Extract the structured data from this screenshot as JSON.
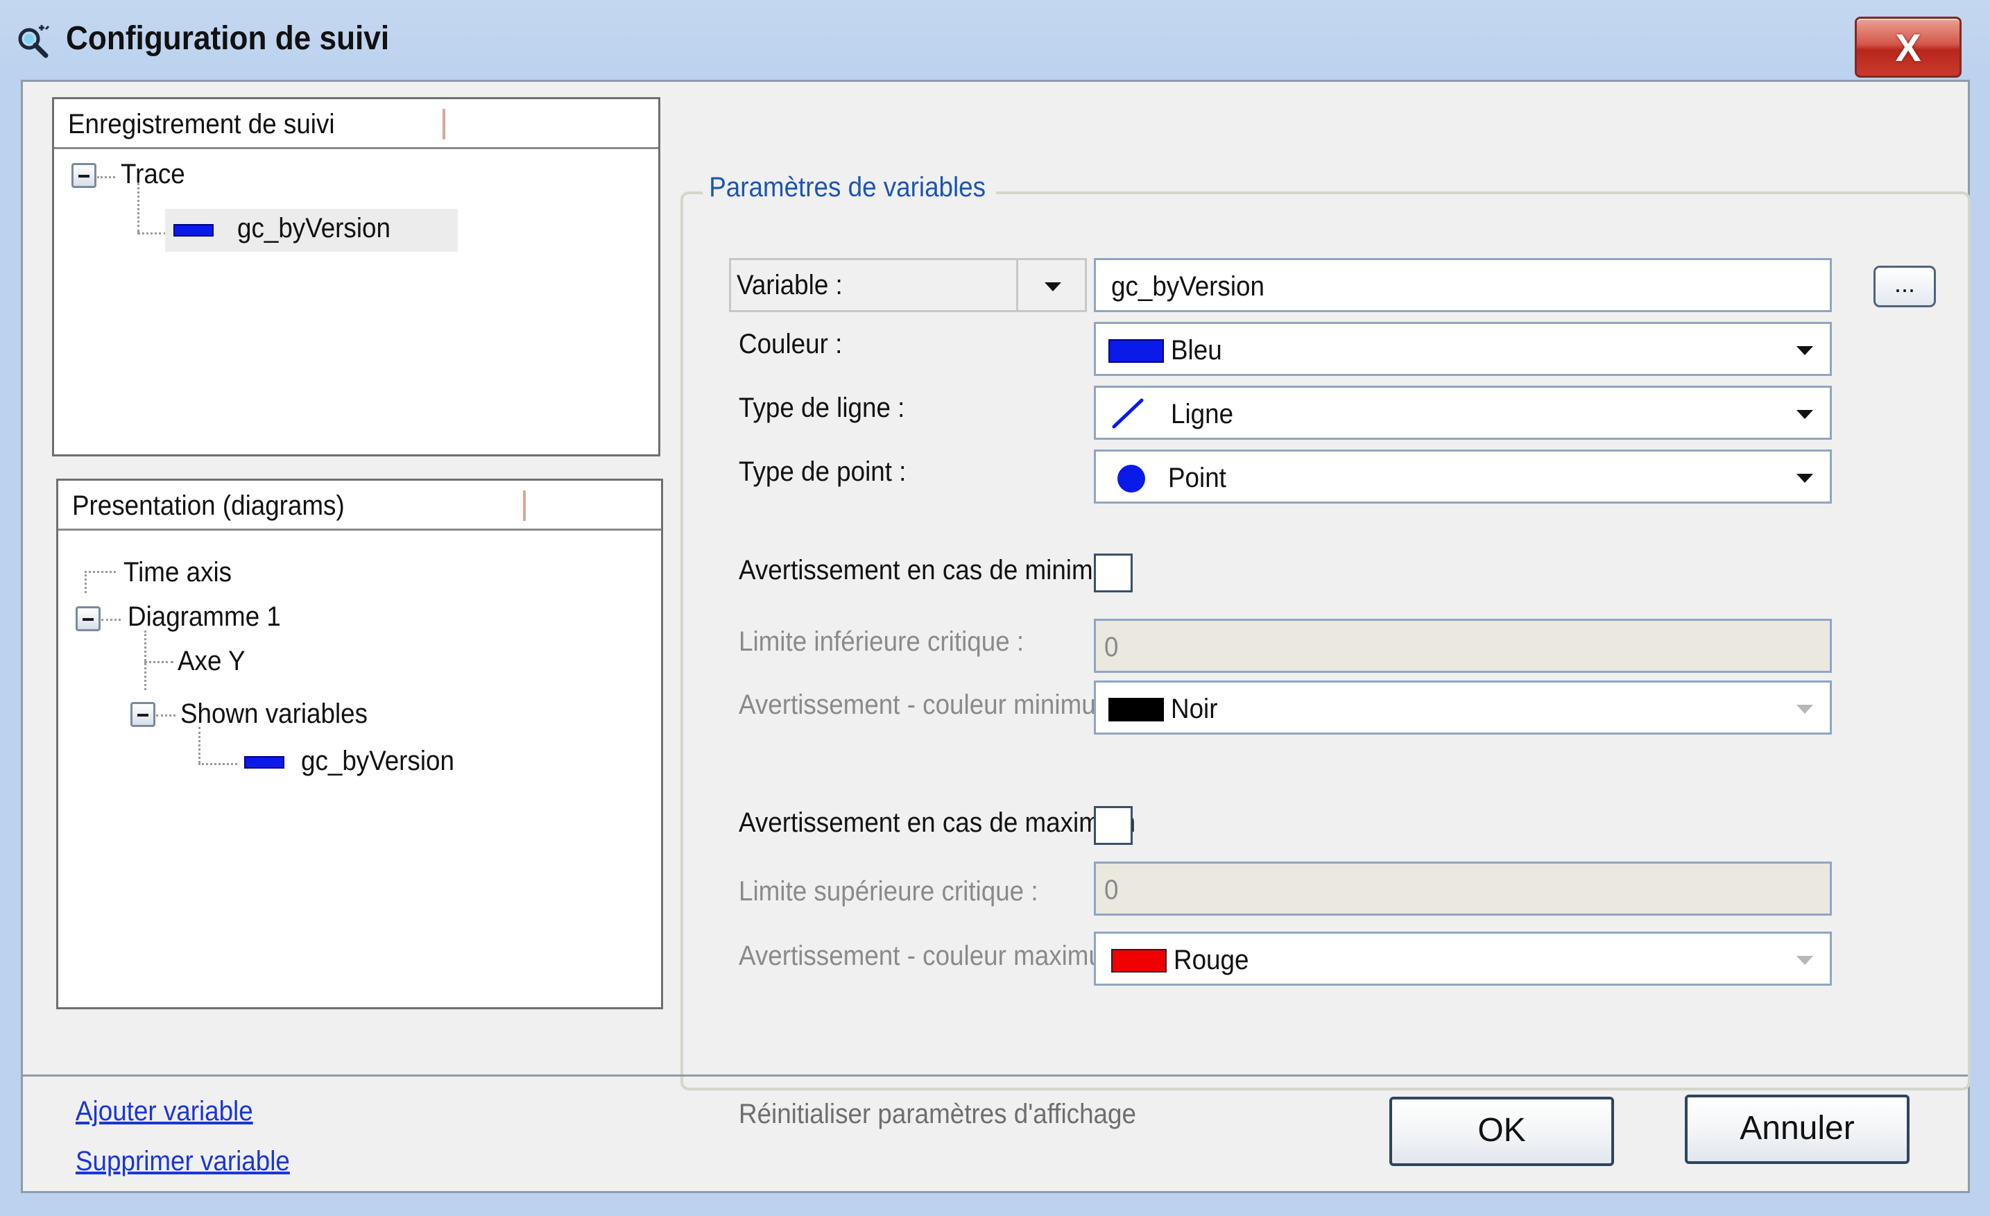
{
  "window": {
    "title": "Configuration de suivi",
    "close_label": "X"
  },
  "recording_panel": {
    "header": "Enregistrement de suivi",
    "tree": {
      "root": "Trace",
      "child": "gc_byVersion"
    }
  },
  "presentation_panel": {
    "header": "Presentation (diagrams)",
    "tree": {
      "time_axis": "Time axis",
      "diagram": "Diagramme 1",
      "y_axis": "Axe Y",
      "shown_variables": "Shown variables",
      "variable": "gc_byVersion"
    }
  },
  "params": {
    "group_title": "Paramètres de variables",
    "variable_combo_label": "Variable :",
    "variable_value": "gc_byVersion",
    "browse_label": "...",
    "color_label": "Couleur :",
    "color_value": "Bleu",
    "line_type_label": "Type de ligne :",
    "line_type_value": "Ligne",
    "point_type_label": "Type de point :",
    "point_type_value": "Point",
    "min_warning_label": "Avertissement en cas de minimum",
    "min_warning_checked": false,
    "lower_limit_label": "Limite inférieure critique :",
    "lower_limit_value": "0",
    "min_color_label": "Avertissement - couleur minimum :",
    "min_color_value": "Noir",
    "max_warning_label": "Avertissement en cas de maximum",
    "max_warning_checked": false,
    "upper_limit_label": "Limite supérieure critique :",
    "upper_limit_value": "0",
    "max_color_label": "Avertissement - couleur maximum :",
    "max_color_value": "Rouge"
  },
  "footer": {
    "add_variable": "Ajouter variable",
    "remove_variable": "Supprimer variable",
    "reset_display": "Réinitialiser paramètres d'affichage",
    "ok": "OK",
    "cancel": "Annuler"
  },
  "colors": {
    "blue": "#0a1ae8",
    "black": "#000000",
    "red": "#f00000",
    "group_title": "#1a55b4",
    "link": "#1a36d8"
  }
}
